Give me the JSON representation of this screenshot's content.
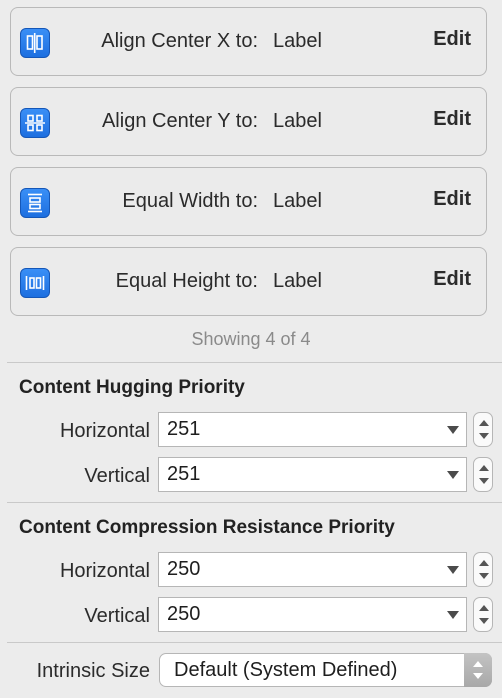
{
  "constraints": [
    {
      "icon": "align-center-x-icon",
      "label": "Align Center X to:",
      "target": "Label",
      "edit": "Edit"
    },
    {
      "icon": "align-center-y-icon",
      "label": "Align Center Y to:",
      "target": "Label",
      "edit": "Edit"
    },
    {
      "icon": "equal-width-icon",
      "label": "Equal Width to:",
      "target": "Label",
      "edit": "Edit"
    },
    {
      "icon": "equal-height-icon",
      "label": "Equal Height to:",
      "target": "Label",
      "edit": "Edit"
    }
  ],
  "showing_text": "Showing 4 of 4",
  "hugging": {
    "title": "Content Hugging Priority",
    "horizontal_label": "Horizontal",
    "horizontal_value": "251",
    "vertical_label": "Vertical",
    "vertical_value": "251"
  },
  "compression": {
    "title": "Content Compression Resistance Priority",
    "horizontal_label": "Horizontal",
    "horizontal_value": "250",
    "vertical_label": "Vertical",
    "vertical_value": "250"
  },
  "intrinsic": {
    "label": "Intrinsic Size",
    "value": "Default (System Defined)"
  },
  "colors": {
    "accent": "#2a7ff0"
  }
}
